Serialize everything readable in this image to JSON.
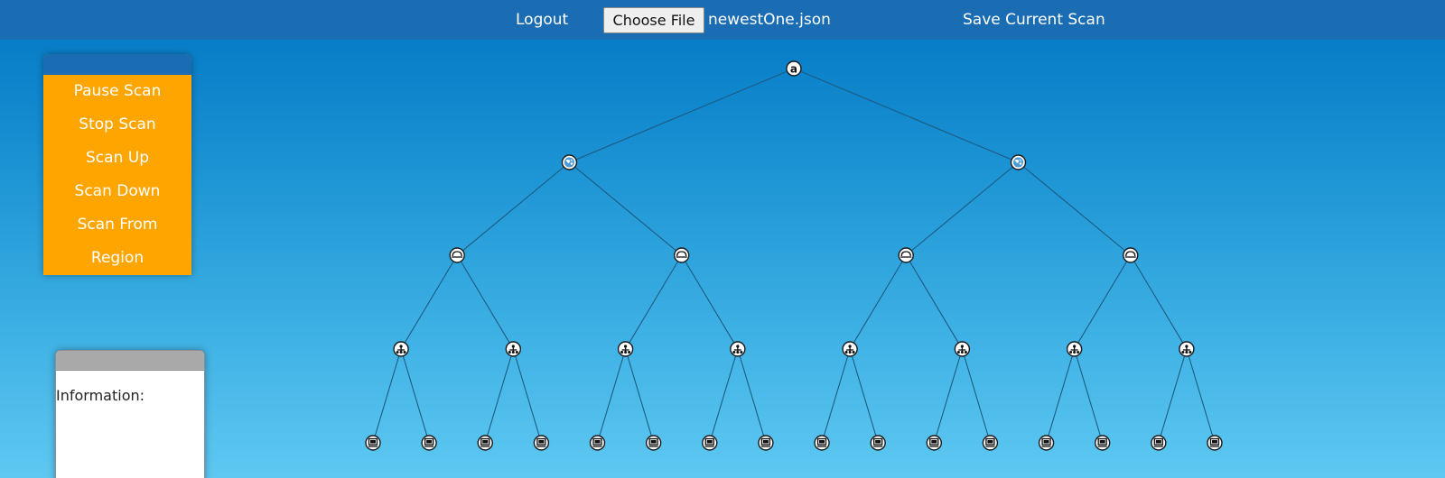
{
  "header": {
    "logout_label": "Logout",
    "choose_file_label": "Choose File",
    "file_name": "newestOne.json",
    "save_label": "Save Current Scan"
  },
  "scan_panel": {
    "items": [
      "Pause Scan",
      "Stop Scan",
      "Scan Up",
      "Scan Down",
      "Scan From",
      "Region"
    ]
  },
  "info_panel": {
    "label": "Information:"
  },
  "tree": {
    "levels": [
      {
        "node_icon": "amazon-icon",
        "count": 1
      },
      {
        "node_icon": "globe-region-icon",
        "count": 2
      },
      {
        "node_icon": "cloud-vpc-icon",
        "count": 4
      },
      {
        "node_icon": "subnet-network-icon",
        "count": 8
      },
      {
        "node_icon": "computer-instance-icon",
        "count": 16
      }
    ]
  },
  "colors": {
    "topbar": "#1a6db3",
    "scan_panel": "#ffa500",
    "background_top": "#0276c4",
    "background_bottom": "#5ec8f2"
  }
}
